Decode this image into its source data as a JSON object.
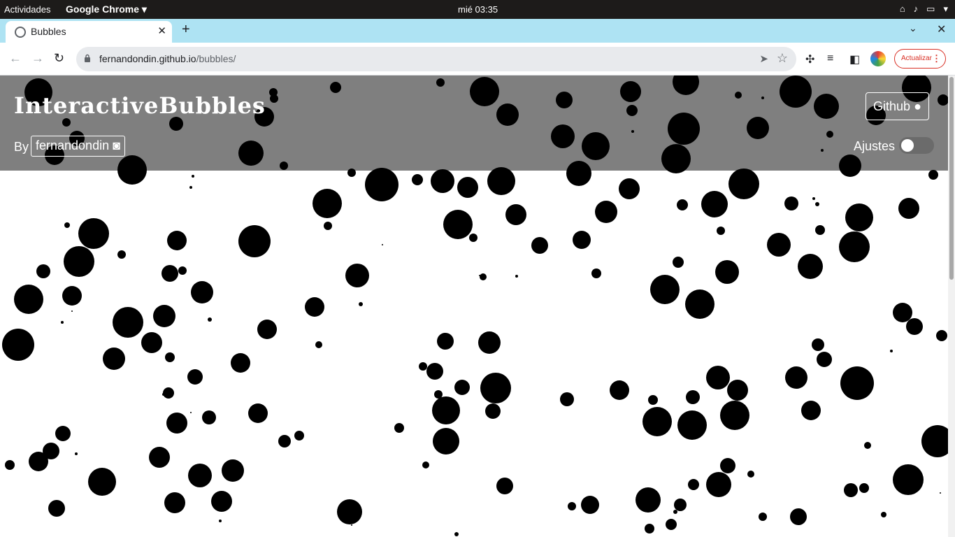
{
  "os_bar": {
    "activities": "Actividades",
    "app_name": "Google Chrome",
    "clock": "mié 03:35"
  },
  "browser": {
    "tab_title": "Bubbles",
    "url_domain": "fernandondin.github.io",
    "url_path": "/bubbles/",
    "update_label": "Actualizar"
  },
  "site": {
    "brand": "InteractiveBubbles",
    "by": "By",
    "author": "fernandondin",
    "github_label": "Github",
    "settings_label": "Ajustes",
    "settings_enabled": false,
    "header_color": "#7f7f7f",
    "bubble_color": "#000000"
  },
  "icons": [
    "globe-icon",
    "close-icon",
    "plus-icon",
    "chevron-down-icon",
    "back-arrow-icon",
    "forward-arrow-icon",
    "reload-icon",
    "lock-icon",
    "send-icon",
    "star-icon",
    "extensions-icon",
    "media-queue-icon",
    "side-panel-icon",
    "avatar-icon",
    "kebab-icon",
    "github-icon",
    "discord-icon"
  ]
}
